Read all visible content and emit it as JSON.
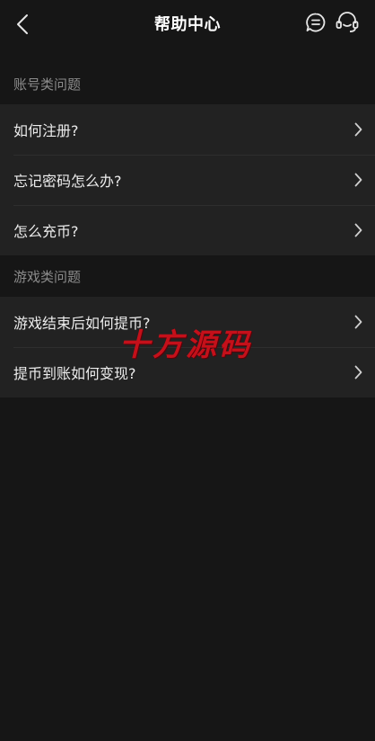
{
  "header": {
    "title": "帮助中心"
  },
  "sections": [
    {
      "title": "账号类问题",
      "items": [
        {
          "label": "如何注册?"
        },
        {
          "label": "忘记密码怎么办?"
        },
        {
          "label": "怎么充币?"
        }
      ]
    },
    {
      "title": "游戏类问题",
      "items": [
        {
          "label": "游戏结束后如何提币?"
        },
        {
          "label": "提币到账如何变现?"
        }
      ]
    }
  ],
  "watermark": "十方源码",
  "colors": {
    "background": "#161616",
    "row_background": "#222222",
    "watermark": "#c4101a"
  }
}
